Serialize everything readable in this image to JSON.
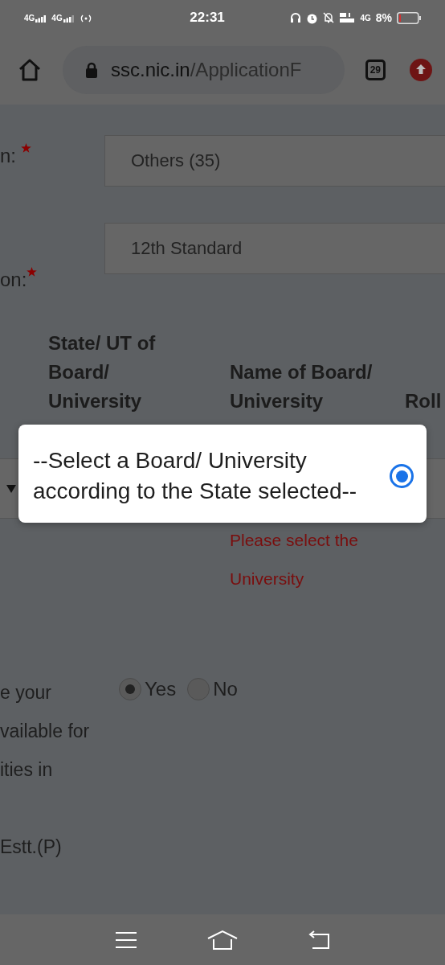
{
  "status_bar": {
    "signals": [
      "4G",
      "4G"
    ],
    "time": "22:31",
    "network": "4G",
    "battery_text": "8%"
  },
  "browser": {
    "url_host": "ssc.nic.in",
    "url_path": "/ApplicationF",
    "tab_count": "29"
  },
  "form": {
    "fields": [
      {
        "label": "n:",
        "required": true,
        "value": "Others (35)"
      },
      {
        "label": "on:",
        "required": true,
        "value": "12th Standard"
      }
    ],
    "table_headers": [
      "State/ UT of Board/ University",
      "Name of Board/ University",
      "Roll"
    ],
    "error": "Please select the University",
    "question_lines": [
      "e your",
      "vailable for",
      "ities in"
    ],
    "options": [
      {
        "label": "Yes",
        "selected": true
      },
      {
        "label": "No",
        "selected": false
      }
    ],
    "note": "Estt.(P)"
  },
  "dropdown": {
    "options": [
      {
        "label": "--Select a Board/ University according to the State selected--",
        "selected": true
      }
    ]
  }
}
